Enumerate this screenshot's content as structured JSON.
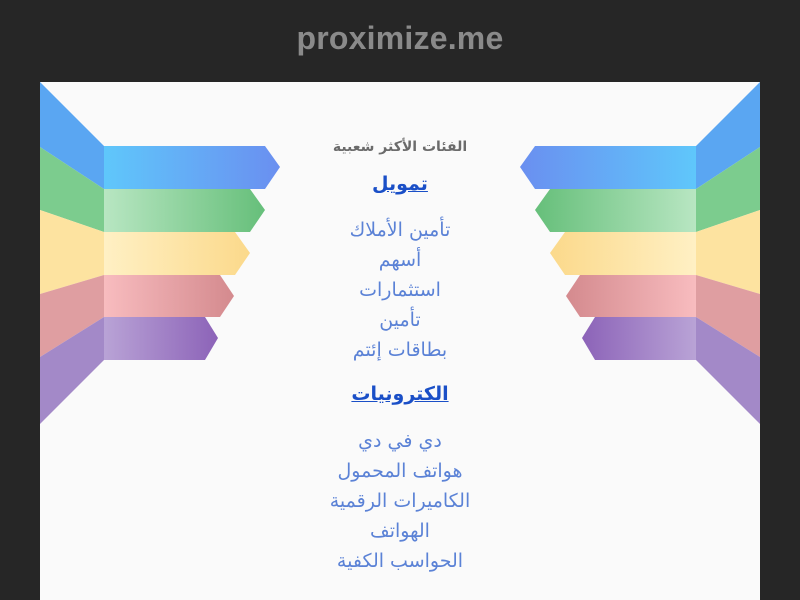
{
  "header": {
    "domain": "proximize.me"
  },
  "colors": {
    "background": "#262626",
    "panel": "#fafafa",
    "title_link": "#1a4fc7",
    "sub_link": "#5b82d6",
    "ribbon_blue": "#5aa9f8",
    "ribbon_green": "#7ccc8e",
    "ribbon_yellow": "#fde4a3",
    "ribbon_red": "#e9a2a4",
    "ribbon_purple": "#9d7bc0"
  },
  "main": {
    "popular_heading": "الفئات الأكثر شعبية",
    "categories": [
      {
        "title": "تمويل",
        "links": [
          "تأمين الأملاك",
          "أسهم",
          "استثمارات",
          "تأمين",
          "بطاقات إئتم"
        ]
      },
      {
        "title": "الكترونيات",
        "links": [
          "دي في دي",
          "هواتف المحمول",
          "الكاميرات الرقمية",
          "الهواتف",
          "الحواسب الكفية"
        ]
      }
    ]
  }
}
